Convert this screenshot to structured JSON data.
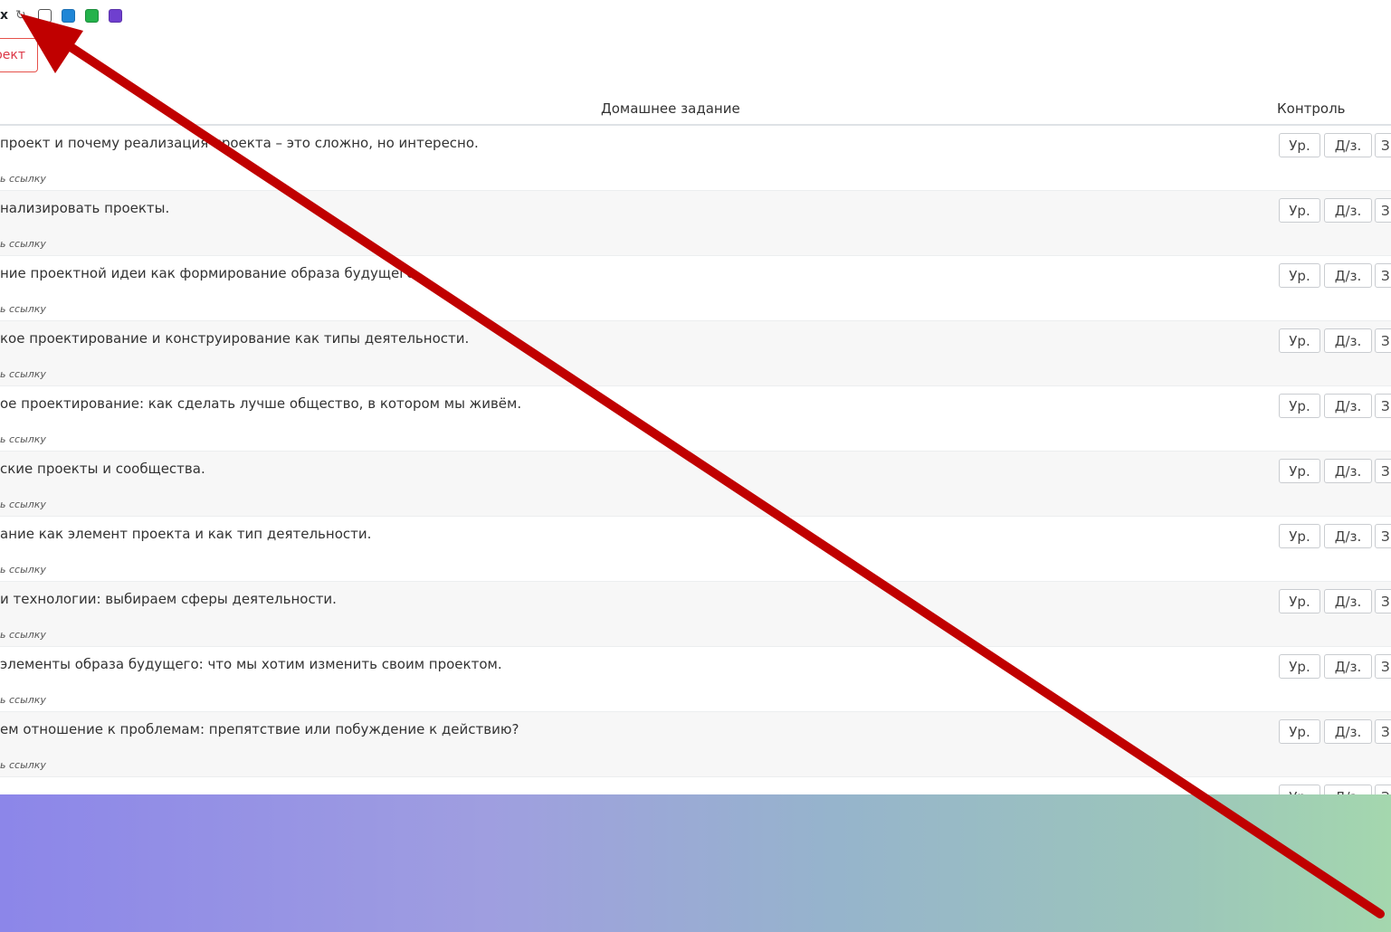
{
  "toolbar": {
    "text": "x",
    "cycle_icon": "refresh-icon",
    "swatches": [
      {
        "name": "white",
        "color": "#ffffff"
      },
      {
        "name": "blue",
        "color": "#1f86d6"
      },
      {
        "name": "green",
        "color": "#24b24b"
      },
      {
        "name": "purple",
        "color": "#6f3fcf"
      }
    ]
  },
  "project_button": {
    "label": "оект"
  },
  "table": {
    "headers": {
      "homework": "Домашнее задание",
      "control": "Контроль"
    },
    "buttons": {
      "lesson": "Ур.",
      "homework": "Д/з.",
      "third": "З"
    },
    "rows": [
      {
        "topic": "проект и почему реализация проекта – это сложно, но интересно.",
        "link": "ь ссылку"
      },
      {
        "topic": "нализировать проекты.",
        "link": "ь ссылку"
      },
      {
        "topic": "ние проектной идеи как формирование образа будущего.",
        "link": "ь ссылку"
      },
      {
        "topic": "кое проектирование и конструирование как типы деятельности.",
        "link": "ь ссылку"
      },
      {
        "topic": "ое проектирование: как сделать лучше общество, в котором мы живём.",
        "link": "ь ссылку"
      },
      {
        "topic": "ские проекты и сообщества.",
        "link": "ь ссылку"
      },
      {
        "topic": "ание как элемент проекта и как тип деятельности.",
        "link": "ь ссылку"
      },
      {
        "topic": "и технологии: выбираем сферы деятельности.",
        "link": "ь ссылку"
      },
      {
        "topic": "элементы образа будущего: что мы хотим изменить своим проектом.",
        "link": "ь ссылку"
      },
      {
        "topic": "ем отношение к проблемам: препятствие или побуждение к действию?",
        "link": "ь ссылку"
      },
      {
        "topic": "",
        "link": ""
      }
    ]
  },
  "annotation": {
    "arrow_color": "#c00000"
  }
}
